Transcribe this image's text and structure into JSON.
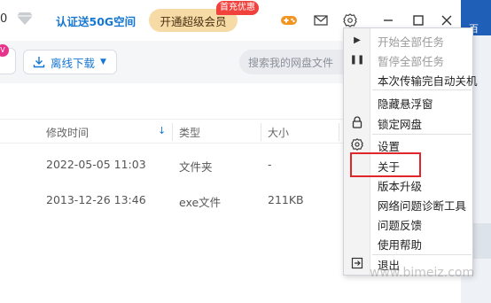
{
  "titlebar": {
    "truncated_text": "0",
    "vip_link": "认证送50G空间",
    "open_vip_button": "开通超级会员",
    "promo_badge": "首充优惠"
  },
  "toolbar": {
    "new_badge": "V",
    "offline_download": "离线下载",
    "search_placeholder": "搜索我的网盘文件"
  },
  "file_list": {
    "columns": [
      "修改时间",
      "类型",
      "大小"
    ],
    "rows": [
      {
        "modified": "2022-05-05 11:03",
        "type": "文件夹",
        "size": "-"
      },
      {
        "modified": "2013-12-26 13:46",
        "type": "exe文件",
        "size": "211KB"
      }
    ]
  },
  "menu": {
    "items": [
      {
        "label": "开始全部任务",
        "disabled": true,
        "icon": "play-icon"
      },
      {
        "label": "暂停全部任务",
        "disabled": true,
        "icon": "pause-icon"
      },
      {
        "label": "本次传输完自动关机",
        "disabled": false,
        "icon": ""
      },
      {
        "label": "隐藏悬浮窗",
        "disabled": false,
        "icon": ""
      },
      {
        "label": "锁定网盘",
        "disabled": false,
        "icon": "lock-icon"
      },
      {
        "label": "设置",
        "disabled": false,
        "icon": "gear-icon"
      },
      {
        "label": "关于",
        "disabled": false,
        "icon": "",
        "highlighted": true
      },
      {
        "label": "版本升级",
        "disabled": false,
        "icon": ""
      },
      {
        "label": "网络问题诊断工具",
        "disabled": false,
        "icon": ""
      },
      {
        "label": "问题反馈",
        "disabled": false,
        "icon": ""
      },
      {
        "label": "使用帮助",
        "disabled": false,
        "icon": ""
      },
      {
        "label": "退出",
        "disabled": false,
        "icon": "exit-icon"
      }
    ]
  },
  "desktop": {
    "title_fragment": "百"
  },
  "watermark": "www.bimeiz.com",
  "colors": {
    "accent": "#1677d2",
    "vip_gold": "#f7dba6",
    "promo_red": "#f0413c",
    "highlight_red": "#e0262b"
  }
}
